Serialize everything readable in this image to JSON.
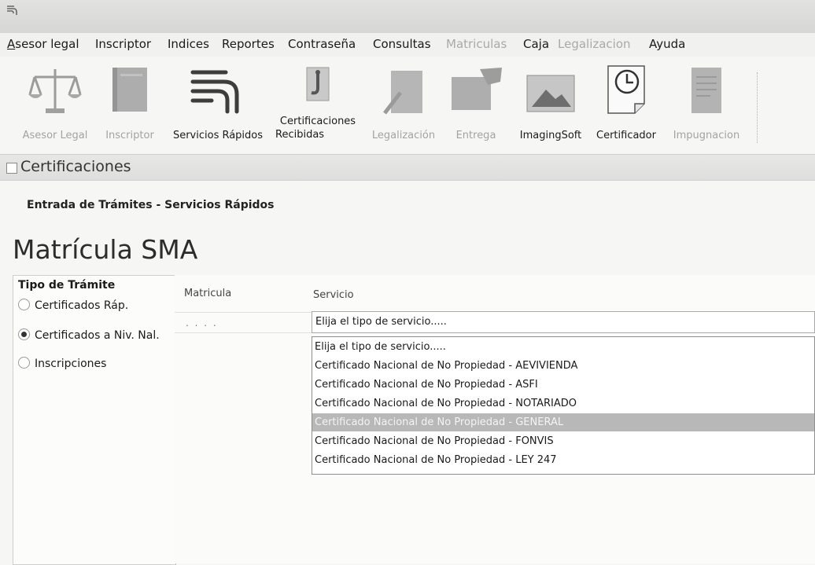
{
  "menu": [
    {
      "label": "Asesor legal",
      "enabled": true
    },
    {
      "label": "Inscriptor",
      "enabled": true
    },
    {
      "label": "Indices",
      "enabled": true
    },
    {
      "label": "Reportes",
      "enabled": true
    },
    {
      "label": "Contraseña",
      "enabled": true
    },
    {
      "label": "Consultas",
      "enabled": true
    },
    {
      "label": "Matriculas",
      "enabled": false
    },
    {
      "label": "Caja",
      "enabled": true
    },
    {
      "label": "Legalizacion",
      "enabled": false
    },
    {
      "label": "Ayuda",
      "enabled": true
    }
  ],
  "toolbar": [
    {
      "label": "Asesor Legal",
      "icon": "scales-icon",
      "enabled": false
    },
    {
      "label": "Inscriptor",
      "icon": "book-icon",
      "enabled": false
    },
    {
      "label": "Servicios Rápidos",
      "icon": "quick-services-icon",
      "enabled": true
    },
    {
      "label_line1": "Certificaciones",
      "label_line2": "Recibidas",
      "icon": "certificate-received-icon",
      "enabled": true
    },
    {
      "label": "Legalización",
      "icon": "legalization-icon",
      "enabled": false
    },
    {
      "label": "Entrega",
      "icon": "delivery-icon",
      "enabled": false
    },
    {
      "label": "ImagingSoft",
      "icon": "image-icon",
      "enabled": true
    },
    {
      "label": "Certificador",
      "icon": "clock-document-icon",
      "enabled": true
    },
    {
      "label": "Impugnacion",
      "icon": "document-icon",
      "enabled": false
    }
  ],
  "section": {
    "title": "Certificaciones"
  },
  "content": {
    "header": "Entrada de Trámites - Servicios Rápidos",
    "title": "Matrícula SMA"
  },
  "tipo_tramite": {
    "title": "Tipo de Trámite",
    "options": [
      {
        "label": "Certificados Ráp.",
        "checked": false
      },
      {
        "label": "Certificados a Niv. Nal.",
        "checked": true
      },
      {
        "label": "Inscripciones",
        "checked": false
      }
    ]
  },
  "grid": {
    "col_matricula": "Matricula",
    "col_servicio": "Servicio",
    "matricula_mask": ". . . .",
    "servicio_value": "Elija el tipo de servicio....."
  },
  "dropdown": {
    "options": [
      "Elija el tipo de servicio.....",
      "Certificado Nacional de No Propiedad - AEVIVIENDA",
      "Certificado Nacional de No Propiedad - ASFI",
      "Certificado Nacional de No Propiedad - NOTARIADO",
      "Certificado Nacional de No Propiedad - GENERAL",
      "Certificado Nacional de No Propiedad - FONVIS",
      "Certificado Nacional de No Propiedad - LEY 247"
    ],
    "highlighted_index": 4
  }
}
